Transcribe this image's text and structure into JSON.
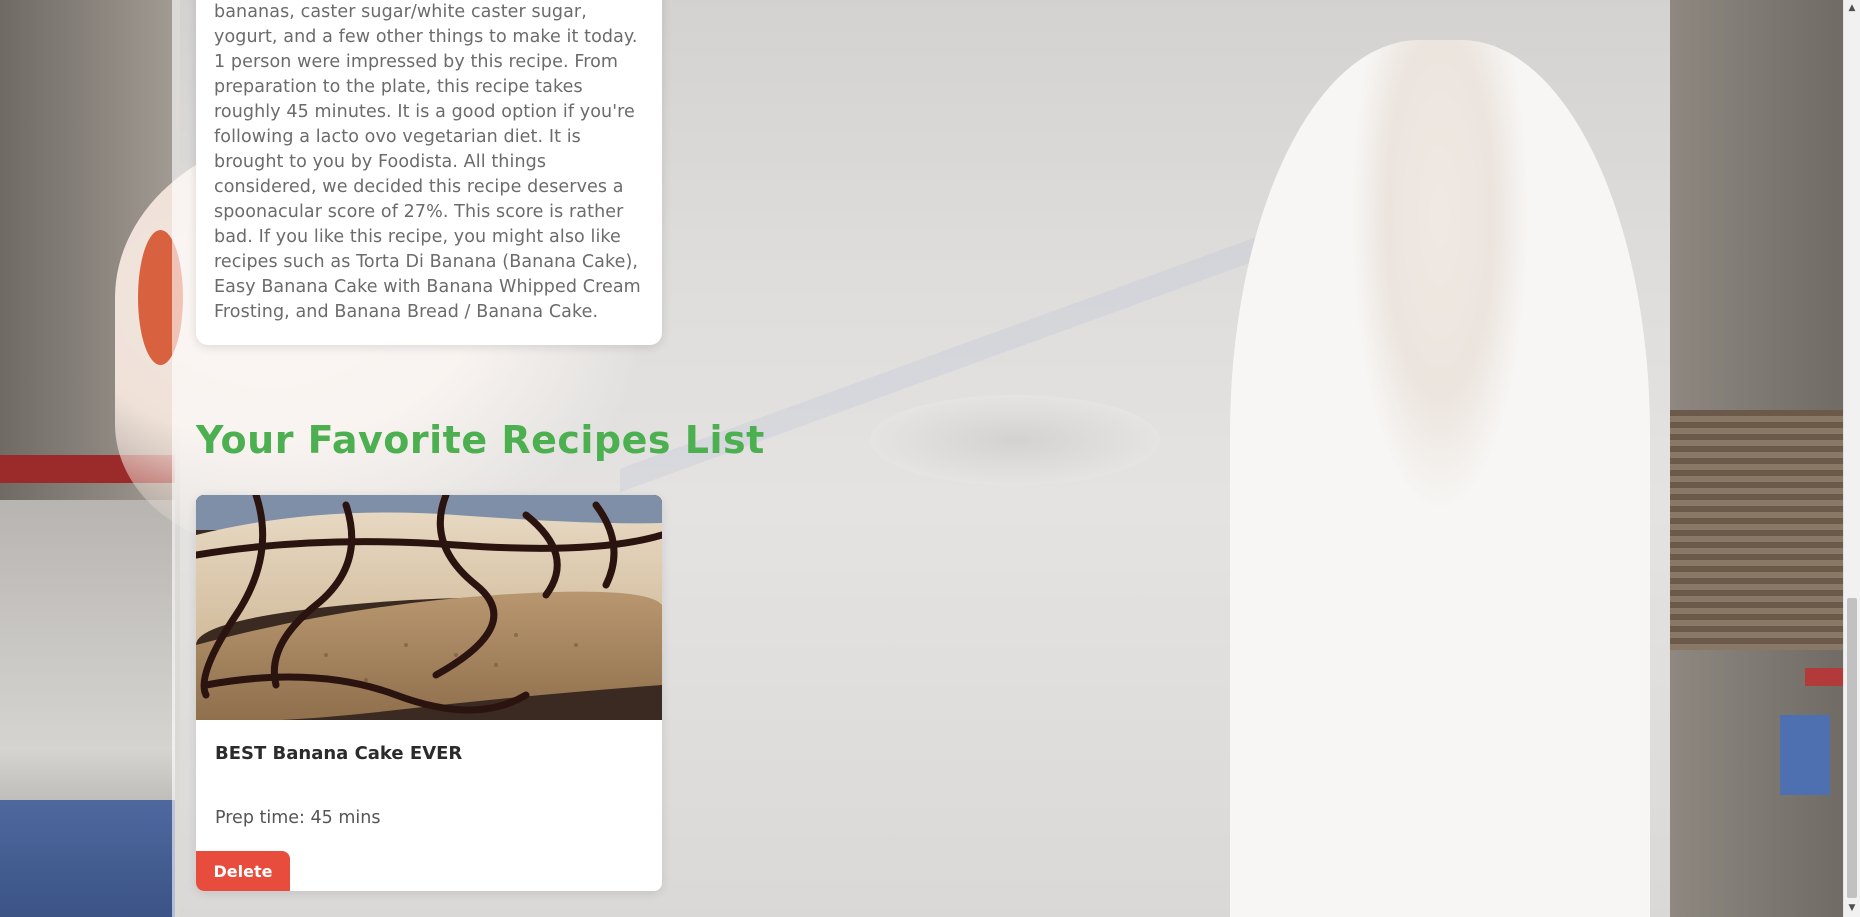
{
  "recipe_summary": {
    "text": "bananas, caster sugar/white caster sugar, yogurt, and a few other things to make it today. 1 person were impressed by this recipe. From preparation to the plate, this recipe takes roughly 45 minutes. It is a good option if you're following a lacto ovo vegetarian diet. It is brought to you by Foodista. All things considered, we decided this recipe deserves a spoonacular score of 27%. This score is rather bad. If you like this recipe, you might also like recipes such as Torta Di Banana (Banana Cake), Easy Banana Cake with Banana Whipped Cream Frosting, and Banana Bread / Banana Cake."
  },
  "favorites": {
    "title": "Your Favorite Recipes List",
    "items": [
      {
        "name": "BEST Banana Cake EVER",
        "prep_time": "Prep time: 45 mins",
        "delete_label": "Delete"
      }
    ]
  },
  "colors": {
    "title_green": "#4caf50",
    "delete_red": "#e74c3c"
  },
  "icons": {
    "scroll_up": "scroll-up-arrow",
    "scroll_down": "scroll-down-arrow"
  }
}
